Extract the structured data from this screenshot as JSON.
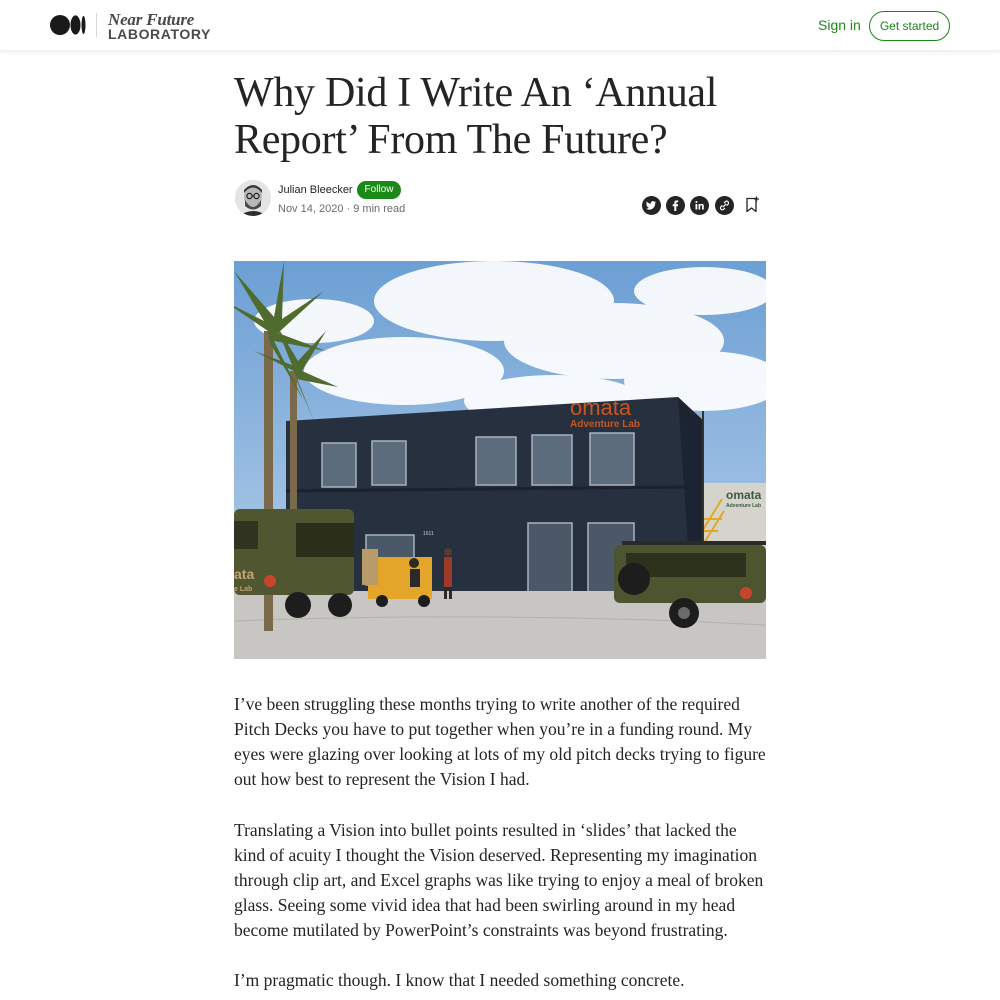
{
  "header": {
    "publication_name_line1": "Near Future",
    "publication_name_line2": "LABORATORY",
    "sign_in_label": "Sign in",
    "get_started_label": "Get started"
  },
  "article": {
    "title": "Why Did I Write An ‘Annual Report’ From The Future?",
    "author": {
      "name": "Julian Bleecker",
      "follow_label": "Follow",
      "date": "Nov 14, 2020",
      "separator": "·",
      "read_time": "9 min read"
    },
    "share_icons": [
      "twitter-icon",
      "facebook-icon",
      "linkedin-icon",
      "link-icon",
      "bookmark-icon"
    ],
    "hero_image": {
      "sign_line1": "omata",
      "sign_line2": "Adventure Lab",
      "side_sign_line1": "omata",
      "side_sign_line2": "Adventure Lab",
      "door_number": "1611",
      "truck_text": "ata",
      "truck_text2": "e Lab"
    },
    "paragraphs": [
      "I’ve been struggling these months trying to write another of the required Pitch Decks you have to put together when you’re in a funding round. My eyes were glazing over looking at lots of my old pitch decks trying to figure out how best to represent the Vision I had.",
      "Translating a Vision into bullet points resulted in ‘slides’ that lacked the kind of acuity I thought the Vision deserved. Representing my imagination through clip art, and Excel graphs was like trying to enjoy a meal of broken glass. Seeing some vivid idea that had been swirling around in my head become mutilated by PowerPoint’s constraints was beyond frustrating.",
      "I’m pragmatic though. I know that I needed something concrete."
    ]
  },
  "colors": {
    "accent_green": "#1a8917",
    "text": "#242424",
    "muted": "#6b6b6b"
  }
}
